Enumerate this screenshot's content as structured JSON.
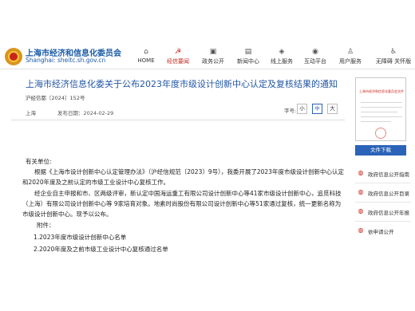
{
  "header": {
    "site_title": "上海市经济和信息化委员会",
    "site_domain": "Shanghai: sheitc.sh.gov.cn",
    "nav": [
      {
        "label": "HOME",
        "icon": "home-icon",
        "glyph": "⌂"
      },
      {
        "label": "经信要闻",
        "icon": "party-emblem-icon",
        "glyph": "☭"
      },
      {
        "label": "政务公开",
        "icon": "government-icon",
        "glyph": "▣"
      },
      {
        "label": "新闻中心",
        "icon": "news-icon",
        "glyph": "▤"
      },
      {
        "label": "线上服务",
        "icon": "service-icon",
        "glyph": "◈"
      },
      {
        "label": "互动平台",
        "icon": "chat-icon",
        "glyph": "◉"
      },
      {
        "label": "用户服务",
        "icon": "user-icon",
        "glyph": "♙"
      },
      {
        "label": "无障碍 关怀版",
        "icon": "accessibility-icon",
        "glyph": "♿"
      }
    ],
    "active_color": "#c8261b"
  },
  "article": {
    "title": "上海市经济信息化委关于公布2023年度市级设计创新中心认定及复核结果的通知",
    "doc_no": "沪经信都〔2024〕152号",
    "source_label": "上海",
    "date_label": "发布日期：2024-02-29",
    "font_size_label": "字号:",
    "font_sizes": [
      "小",
      "中",
      "大"
    ],
    "salutation": "有关单位:",
    "paragraph1": "根据《上海市设计创新中心认定管理办法》（沪经信规范〔2023〕9号），我委开展了2023年度市级设计创新中心认定和2020年度及之前认定的市级工业设计中心复核工作。",
    "paragraph2": "经企业自主申报和市、区两级评审，新认定中国海运重工有限公司设计创新中心等41家市级设计创新中心，追觅科技（上海）有限公司设计创新中心等 9家培育对象。地素时尚股份有限公司设计创新中心等51家通过复核，统一更新名称为市级设计创新中心。现予以公布。",
    "attachments_title": "附件：",
    "attachments": [
      "1.2023年度市级设计创新中心名单",
      "2.2020年度及之前市级工业设计中心复核通过名单"
    ]
  },
  "sidebar": {
    "thumbnail_title": "上海市经济和信息化委员会文件",
    "download_label": "文件下载",
    "links": [
      {
        "label": "政府信息公开指南",
        "icon": "guide-icon",
        "glyph": "◍"
      },
      {
        "label": "政府信息公开目录",
        "icon": "catalog-icon",
        "glyph": "◍"
      },
      {
        "label": "政府信息公开年报",
        "icon": "report-icon",
        "glyph": "◍"
      },
      {
        "label": "依申请公开",
        "icon": "apply-icon",
        "glyph": "◍"
      }
    ],
    "accent_color": "#2a63b8"
  }
}
